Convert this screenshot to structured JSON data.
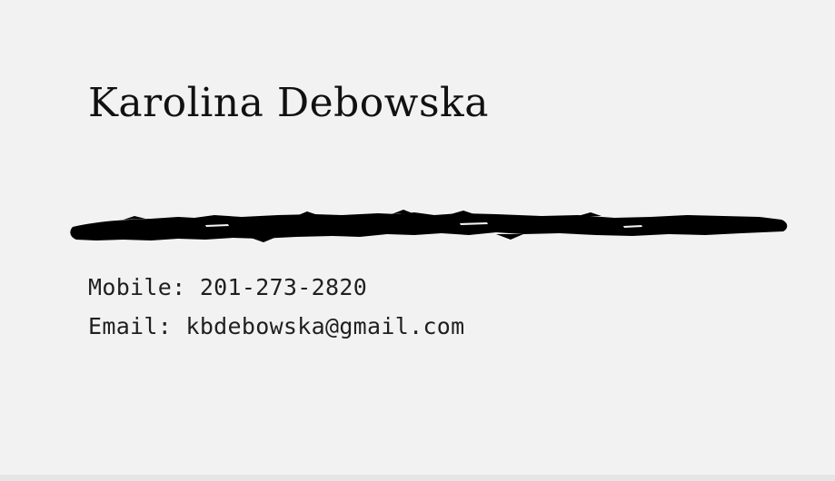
{
  "card": {
    "name": "Karolina Debowska",
    "mobile_label": "Mobile:",
    "mobile_value": "201-273-2820",
    "email_label": "Email:",
    "email_value": "kbdebowska@gmail.com"
  },
  "colors": {
    "background": "#f2f2f2",
    "ink": "#111111",
    "brush": "#000000"
  }
}
